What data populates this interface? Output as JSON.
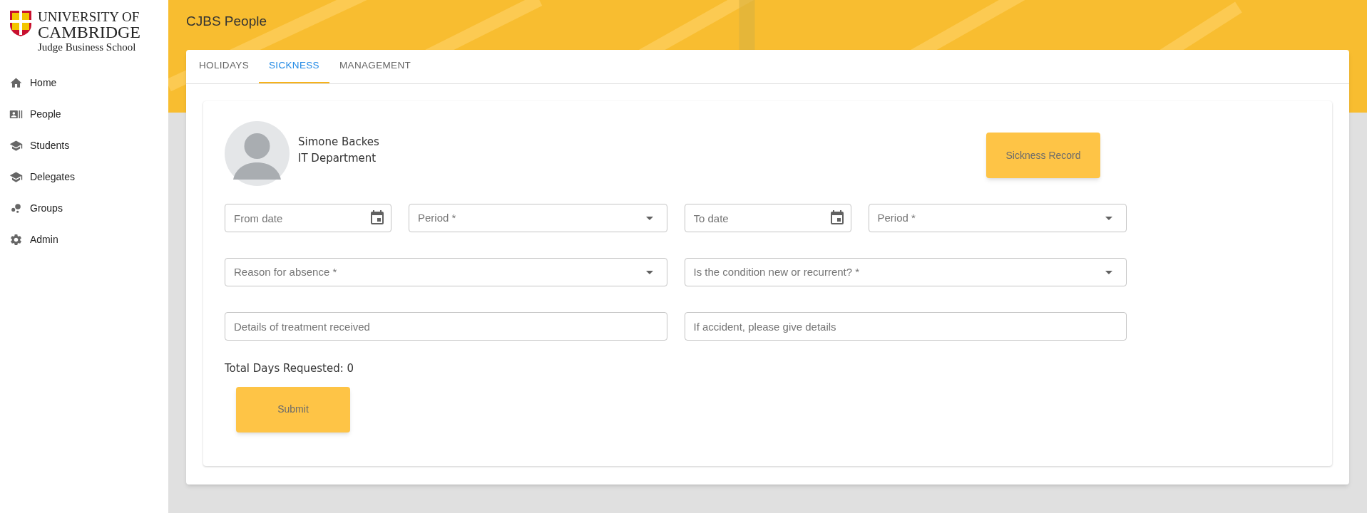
{
  "logo": {
    "lines": [
      "UNIVERSITY OF",
      "CAMBRIDGE",
      "Judge Business School"
    ]
  },
  "sidebar": {
    "items": [
      {
        "label": "Home"
      },
      {
        "label": "People"
      },
      {
        "label": "Students"
      },
      {
        "label": "Delegates"
      },
      {
        "label": "Groups"
      },
      {
        "label": "Admin"
      }
    ]
  },
  "header": {
    "title": "CJBS People"
  },
  "tabs": [
    {
      "label": "HOLIDAYS",
      "selected": false
    },
    {
      "label": "SICKNESS",
      "selected": true
    },
    {
      "label": "MANAGEMENT",
      "selected": false
    }
  ],
  "profile": {
    "name": "Simone Backes",
    "department": "IT Department"
  },
  "record_button": "Sickness Record",
  "form_rows": [
    [
      {
        "kind": "date",
        "placeholder": "From date"
      },
      {
        "kind": "select",
        "placeholder": "Period *"
      },
      {
        "kind": "date",
        "placeholder": "To date"
      },
      {
        "kind": "select",
        "placeholder": "Period *"
      }
    ],
    [
      {
        "kind": "select",
        "placeholder": "Reason for absence *"
      },
      {
        "kind": "select",
        "placeholder": "Is the condition new or recurrent? *"
      }
    ],
    [
      {
        "kind": "text",
        "placeholder": "Details of treatment received"
      },
      {
        "kind": "text",
        "placeholder": "If accident, please give details"
      }
    ]
  ],
  "total": "Total Days Requested: 0",
  "submit": "Submit"
}
